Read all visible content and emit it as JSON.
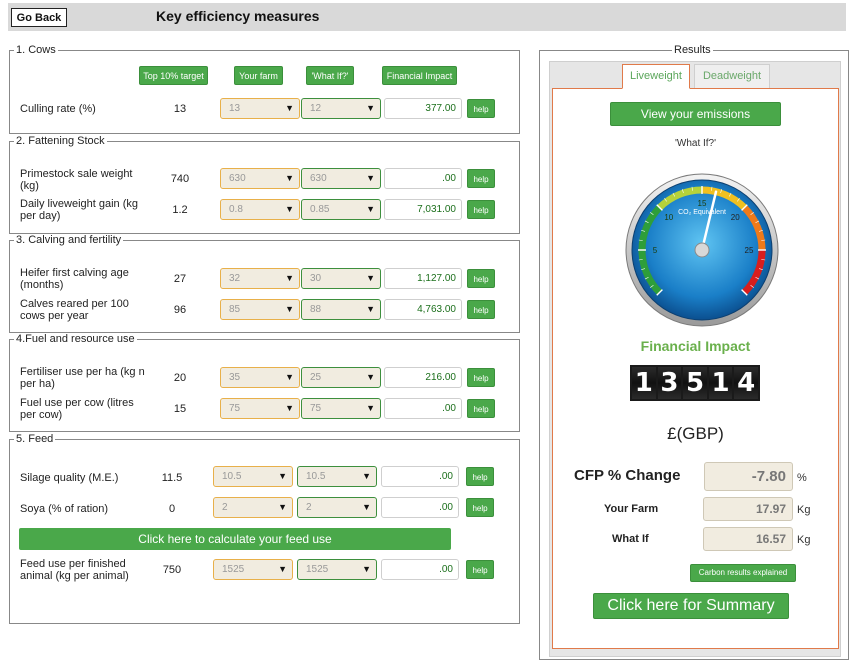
{
  "header": {
    "go_back": "Go Back",
    "title": "Key efficiency measures"
  },
  "columns": {
    "top10": "Top 10% target",
    "your_farm": "Your farm",
    "what_if": "'What If?'",
    "financial": "Financial Impact"
  },
  "help_label": "help",
  "sections": {
    "cows": {
      "legend": "1. Cows",
      "rows": [
        {
          "label": "Culling rate (%)",
          "top10": "13",
          "your_farm": "13",
          "what_if": "12",
          "financial": "377.00"
        }
      ]
    },
    "fattening": {
      "legend": "2. Fattening Stock",
      "rows": [
        {
          "label": "Primestock sale weight (kg)",
          "top10": "740",
          "your_farm": "630",
          "what_if": "630",
          "financial": ".00"
        },
        {
          "label": "Daily liveweight gain (kg per day)",
          "top10": "1.2",
          "your_farm": "0.8",
          "what_if": "0.85",
          "financial": "7,031.00"
        }
      ]
    },
    "calving": {
      "legend": "3. Calving and fertility",
      "rows": [
        {
          "label": "Heifer first calving age (months)",
          "top10": "27",
          "your_farm": "32",
          "what_if": "30",
          "financial": "1,127.00"
        },
        {
          "label": "Calves reared per 100 cows per year",
          "top10": "96",
          "your_farm": "85",
          "what_if": "88",
          "financial": "4,763.00"
        }
      ]
    },
    "fuel": {
      "legend": "4.Fuel and resource use",
      "rows": [
        {
          "label": "Fertiliser use per ha (kg n per ha)",
          "top10": "20",
          "your_farm": "35",
          "what_if": "25",
          "financial": "216.00"
        },
        {
          "label": "Fuel use per cow (litres per cow)",
          "top10": "15",
          "your_farm": "75",
          "what_if": "75",
          "financial": ".00"
        }
      ]
    },
    "feed": {
      "legend": "5. Feed",
      "rows": [
        {
          "label": "Silage quality (M.E.)",
          "top10": "11.5",
          "your_farm": "10.5",
          "what_if": "10.5",
          "financial": ".00"
        },
        {
          "label": "Soya (% of ration)",
          "top10": "0",
          "your_farm": "2",
          "what_if": "2",
          "financial": ".00"
        },
        {
          "label": "Feed use per finished animal (kg per animal)",
          "top10": "750",
          "your_farm": "1525",
          "what_if": "1525",
          "financial": ".00"
        }
      ],
      "calc_button": "Click here to calculate your feed use"
    }
  },
  "results": {
    "legend": "Results",
    "tabs": {
      "liveweight": "Liveweight",
      "deadweight": "Deadweight"
    },
    "emissions_button": "View your emissions breakdown",
    "what_if_label": "'What If?'",
    "gauge": {
      "label": "CO₂ Equivalent",
      "ticks": [
        "5",
        "10",
        "15",
        "20",
        "25"
      ],
      "needle_value": 16.5,
      "min": 0,
      "max": 30
    },
    "financial_impact_title": "Financial Impact",
    "counter_digits": [
      "1",
      "3",
      "5",
      "1",
      "4"
    ],
    "currency": "£(GBP)",
    "cfp": {
      "label": "CFP % Change",
      "value": "-7.80",
      "unit": "%"
    },
    "your_farm": {
      "label": "Your Farm",
      "value": "17.97",
      "unit": "Kg"
    },
    "what_if": {
      "label": "What If",
      "value": "16.57",
      "unit": "Kg"
    },
    "carbon_explained": "Carbon results explained",
    "summary_button": "Click here for Summary"
  }
}
